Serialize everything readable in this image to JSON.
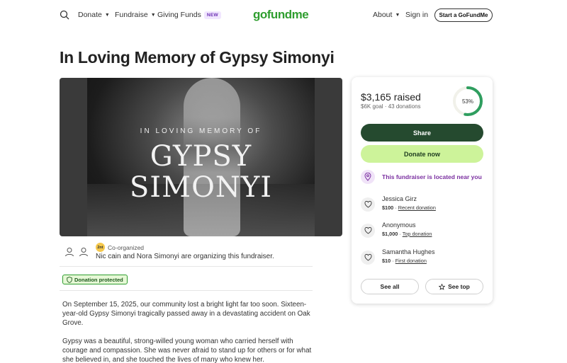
{
  "nav": {
    "donate": "Donate",
    "fundraise": "Fundraise",
    "giving_funds": "Giving Funds",
    "new_badge": "NEW",
    "logo": "gofundme",
    "about": "About",
    "sign_in": "Sign in",
    "start": "Start a GoFundMe"
  },
  "page": {
    "title": "In Loving Memory of Gypsy Simonyi"
  },
  "hero": {
    "memory_text": "IN LOVING MEMORY OF",
    "name_line1": "GYPSY",
    "name_line2": "SIMONYI"
  },
  "organizer": {
    "badge": "2nt",
    "co_label": "Co-organized",
    "text": "Nic cain and Nora Simonyi are organizing this fundraiser.",
    "protected": "Donation protected"
  },
  "story": {
    "paragraph1": "On September 15, 2025, our community lost a bright light far too soon. Sixteen-year-old Gypsy Simonyi tragically passed away in a devastating accident on Oak Grove.",
    "paragraph2": "Gypsy was a beautiful, strong-willed young woman who carried herself with courage and compassion. She was never afraid to stand up for others or for what she believed in, and she touched the lives of many who knew her."
  },
  "card": {
    "raised": "$3,165 raised",
    "goal": "$6K goal",
    "dot": "·",
    "donations": "43 donations",
    "percent_label": "53%",
    "progress": 0.53,
    "share": "Share",
    "donate_now": "Donate now",
    "near": "This fundraiser is located near you",
    "donors": [
      {
        "name": "Jessica Girz",
        "amount": "$100",
        "sep": " · ",
        "type": "Recent donation"
      },
      {
        "name": "Anonymous",
        "amount": "$1,000",
        "sep": " · ",
        "type": "Top donation"
      },
      {
        "name": "Samantha Hughes",
        "amount": "$10",
        "sep": " · ",
        "type": "First donation"
      }
    ],
    "see_all": "See all",
    "see_top": "See top"
  },
  "colors": {
    "brand_green": "#2f9e2f",
    "share_bg": "#254a2f",
    "donate_bg": "#cdf39a",
    "near_text": "#7a2fa0",
    "ring": "#2f9e5f"
  }
}
